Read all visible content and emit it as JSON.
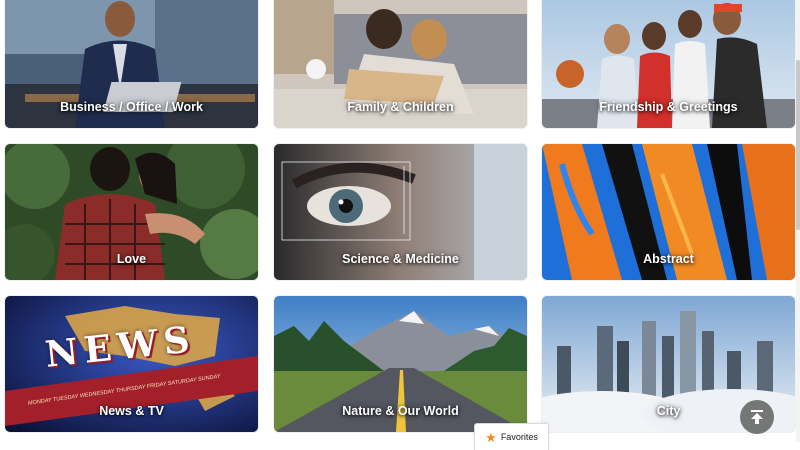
{
  "categories": [
    {
      "label": "Business / Office / Work",
      "accent": "#2f4a6e"
    },
    {
      "label": "Family & Children",
      "accent": "#b89a78"
    },
    {
      "label": "Friendship & Greetings",
      "accent": "#6f8fb0"
    },
    {
      "label": "Love",
      "accent": "#3f6a35"
    },
    {
      "label": "Science & Medicine",
      "accent": "#7a8288"
    },
    {
      "label": "Abstract",
      "accent": "#e8731d"
    },
    {
      "label": "News & TV",
      "accent": "#1b2a6b"
    },
    {
      "label": "Nature & Our World",
      "accent": "#4a7a3a"
    },
    {
      "label": "City",
      "accent": "#9bb9d6"
    }
  ],
  "decor": {
    "news_word": "NEWS",
    "weekdays": "MONDAY TUESDAY WEDNESDAY THURSDAY FRIDAY SATURDAY SUNDAY"
  },
  "favorites": {
    "label": "Favorites",
    "icon": "star-icon",
    "icon_color": "#f28c1b"
  },
  "back_to_top": {
    "icon": "arrow-up-to-top-icon"
  }
}
